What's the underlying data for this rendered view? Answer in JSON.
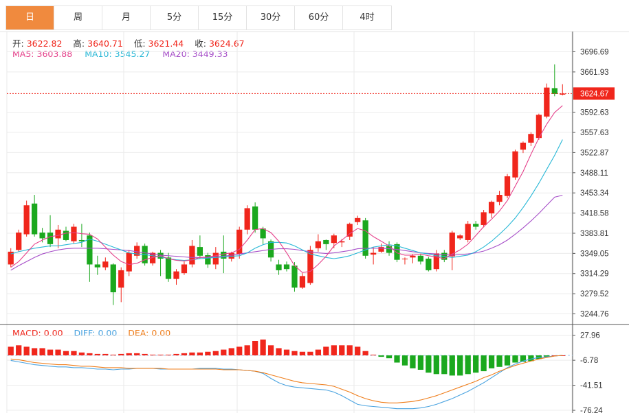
{
  "tabs": [
    {
      "label": "日",
      "active": true
    },
    {
      "label": "周",
      "active": false
    },
    {
      "label": "月",
      "active": false
    },
    {
      "label": "5分",
      "active": false
    },
    {
      "label": "15分",
      "active": false
    },
    {
      "label": "30分",
      "active": false
    },
    {
      "label": "60分",
      "active": false
    },
    {
      "label": "4时",
      "active": false
    }
  ],
  "ohlc_info": {
    "open_label": "开:",
    "open_value": "3622.82",
    "high_label": "高:",
    "high_value": "3640.71",
    "low_label": "低:",
    "low_value": "3621.44",
    "close_label": "收:",
    "close_value": "3624.67"
  },
  "ma_info": {
    "ma5_label": "MA5:",
    "ma5_value": "3603.88",
    "ma10_label": "MA10:",
    "ma10_value": "3545.27",
    "ma20_label": "MA20:",
    "ma20_value": "3449.33"
  },
  "macd_info": {
    "macd_label": "MACD:",
    "macd_value": "0.00",
    "diff_label": "DIFF:",
    "diff_value": "0.00",
    "dea_label": "DEA:",
    "dea_value": "0.00"
  },
  "last_price_label": "3624.67",
  "colors": {
    "up": "#f0261c",
    "down": "#1ba81e",
    "ma5": "#e5408a",
    "ma10": "#27b7d6",
    "ma20": "#a64ec8",
    "diff": "#4aa3e0",
    "dea": "#ef7d1a",
    "accent": "#f08a3e"
  },
  "chart_data": [
    {
      "type": "candlestick",
      "title": "",
      "ylim": [
        3230,
        3715
      ],
      "y_ticks": [
        "3696.69",
        "3661.93",
        "3592.63",
        "3557.63",
        "3522.87",
        "3488.11",
        "3453.34",
        "3418.58",
        "3383.81",
        "3349.05",
        "3314.29",
        "3279.52",
        "3244.76"
      ],
      "last_price": 3624.67,
      "candles": [
        [
          3330,
          3352,
          3325,
          3358
        ],
        [
          3355,
          3385,
          3352,
          3390
        ],
        [
          3382,
          3432,
          3378,
          3440
        ],
        [
          3435,
          3382,
          3378,
          3450
        ],
        [
          3385,
          3375,
          3368,
          3393
        ],
        [
          3385,
          3365,
          3360,
          3415
        ],
        [
          3375,
          3390,
          3358,
          3398
        ],
        [
          3388,
          3372,
          3370,
          3395
        ],
        [
          3370,
          3395,
          3366,
          3400
        ],
        [
          3372,
          3370,
          3360,
          3400
        ],
        [
          3380,
          3330,
          3300,
          3385
        ],
        [
          3330,
          3325,
          3312,
          3345
        ],
        [
          3325,
          3335,
          3320,
          3342
        ],
        [
          3330,
          3282,
          3260,
          3332
        ],
        [
          3290,
          3320,
          3265,
          3325
        ],
        [
          3318,
          3350,
          3310,
          3355
        ],
        [
          3345,
          3362,
          3340,
          3368
        ],
        [
          3362,
          3332,
          3328,
          3366
        ],
        [
          3332,
          3350,
          3328,
          3352
        ],
        [
          3350,
          3340,
          3310,
          3355
        ],
        [
          3342,
          3305,
          3300,
          3350
        ],
        [
          3305,
          3318,
          3295,
          3322
        ],
        [
          3315,
          3330,
          3312,
          3335
        ],
        [
          3330,
          3362,
          3325,
          3372
        ],
        [
          3360,
          3345,
          3340,
          3380
        ],
        [
          3346,
          3330,
          3324,
          3350
        ],
        [
          3330,
          3350,
          3322,
          3360
        ],
        [
          3352,
          3340,
          3315,
          3380
        ],
        [
          3340,
          3350,
          3335,
          3352
        ],
        [
          3348,
          3390,
          3340,
          3395
        ],
        [
          3390,
          3427,
          3382,
          3432
        ],
        [
          3430,
          3390,
          3385,
          3437
        ],
        [
          3392,
          3375,
          3365,
          3395
        ],
        [
          3370,
          3342,
          3335,
          3373
        ],
        [
          3330,
          3320,
          3312,
          3338
        ],
        [
          3330,
          3322,
          3318,
          3335
        ],
        [
          3328,
          3290,
          3283,
          3334
        ],
        [
          3290,
          3310,
          3288,
          3315
        ],
        [
          3298,
          3355,
          3295,
          3362
        ],
        [
          3358,
          3370,
          3352,
          3382
        ],
        [
          3372,
          3365,
          3355,
          3373
        ],
        [
          3367,
          3380,
          3358,
          3383
        ],
        [
          3368,
          3370,
          3360,
          3374
        ],
        [
          3378,
          3400,
          3372,
          3402
        ],
        [
          3403,
          3410,
          3398,
          3414
        ],
        [
          3406,
          3345,
          3340,
          3410
        ],
        [
          3347,
          3350,
          3330,
          3360
        ],
        [
          3352,
          3360,
          3350,
          3366
        ],
        [
          3362,
          3350,
          3345,
          3370
        ],
        [
          3365,
          3338,
          3334,
          3368
        ],
        [
          3340,
          3340,
          3330,
          3342
        ],
        [
          3342,
          3345,
          3332,
          3348
        ],
        [
          3345,
          3335,
          3330,
          3348
        ],
        [
          3340,
          3320,
          3318,
          3343
        ],
        [
          3322,
          3349,
          3318,
          3355
        ],
        [
          3350,
          3338,
          3334,
          3355
        ],
        [
          3344,
          3385,
          3320,
          3388
        ],
        [
          3375,
          3380,
          3372,
          3382
        ],
        [
          3372,
          3400,
          3368,
          3405
        ],
        [
          3400,
          3395,
          3390,
          3405
        ],
        [
          3398,
          3420,
          3394,
          3424
        ],
        [
          3418,
          3438,
          3410,
          3440
        ],
        [
          3438,
          3450,
          3432,
          3457
        ],
        [
          3448,
          3482,
          3444,
          3486
        ],
        [
          3480,
          3525,
          3476,
          3528
        ],
        [
          3528,
          3540,
          3522,
          3542
        ],
        [
          3540,
          3555,
          3534,
          3558
        ],
        [
          3548,
          3588,
          3545,
          3590
        ],
        [
          3585,
          3635,
          3582,
          3642
        ],
        [
          3634,
          3624,
          3620,
          3675
        ],
        [
          3622.82,
          3624.67,
          3621.44,
          3640.71
        ]
      ],
      "ma5": [
        3325,
        3335,
        3350,
        3365,
        3372,
        3378,
        3380,
        3384,
        3385,
        3383,
        3382,
        3374,
        3360,
        3346,
        3335,
        3330,
        3332,
        3338,
        3342,
        3345,
        3340,
        3337,
        3336,
        3338,
        3342,
        3343,
        3345,
        3348,
        3350,
        3356,
        3372,
        3390,
        3392,
        3385,
        3370,
        3350,
        3328,
        3316,
        3318,
        3330,
        3344,
        3362,
        3372,
        3383,
        3392,
        3388,
        3378,
        3370,
        3362,
        3350,
        3346,
        3346,
        3348,
        3345,
        3343,
        3340,
        3348,
        3355,
        3365,
        3380,
        3395,
        3408,
        3422,
        3440,
        3465,
        3490,
        3520,
        3548,
        3572,
        3592,
        3603.88
      ],
      "ma10": [
        3348,
        3352,
        3355,
        3358,
        3360,
        3362,
        3362,
        3364,
        3366,
        3368,
        3374,
        3370,
        3365,
        3360,
        3355,
        3350,
        3348,
        3347,
        3345,
        3343,
        3340,
        3338,
        3337,
        3338,
        3340,
        3341,
        3342,
        3343,
        3344,
        3345,
        3350,
        3358,
        3364,
        3368,
        3368,
        3367,
        3362,
        3355,
        3348,
        3345,
        3342,
        3340,
        3342,
        3345,
        3350,
        3355,
        3360,
        3362,
        3364,
        3362,
        3358,
        3354,
        3350,
        3348,
        3345,
        3344,
        3342,
        3344,
        3346,
        3352,
        3360,
        3370,
        3382,
        3395,
        3410,
        3428,
        3448,
        3470,
        3494,
        3518,
        3545.27
      ],
      "ma20": [
        3320,
        3328,
        3335,
        3342,
        3348,
        3352,
        3355,
        3357,
        3358,
        3358,
        3358,
        3358,
        3357,
        3356,
        3355,
        3354,
        3352,
        3350,
        3348,
        3346,
        3345,
        3344,
        3343,
        3342,
        3342,
        3342,
        3343,
        3344,
        3346,
        3348,
        3350,
        3352,
        3354,
        3356,
        3357,
        3357,
        3356,
        3354,
        3352,
        3350,
        3349,
        3350,
        3352,
        3354,
        3357,
        3358,
        3358,
        3358,
        3357,
        3356,
        3354,
        3352,
        3350,
        3349,
        3348,
        3347,
        3346,
        3347,
        3348,
        3350,
        3353,
        3358,
        3364,
        3372,
        3382,
        3393,
        3405,
        3418,
        3432,
        3446,
        3449.33
      ]
    },
    {
      "type": "bar",
      "title": "MACD",
      "ylim": [
        -80,
        40
      ],
      "y_ticks": [
        "27.96",
        "-6.78",
        "-41.51",
        "-76.24"
      ],
      "macd": [
        12,
        14,
        12,
        10,
        10,
        8,
        8,
        6,
        6,
        4,
        3,
        2,
        2,
        1,
        2,
        3,
        3,
        2,
        1,
        1,
        1,
        2,
        3,
        4,
        4,
        5,
        6,
        8,
        10,
        12,
        14,
        20,
        22,
        14,
        10,
        8,
        6,
        5,
        5,
        8,
        12,
        14,
        14,
        14,
        12,
        6,
        1,
        -2,
        -4,
        -10,
        -14,
        -18,
        -20,
        -24,
        -26,
        -26,
        -28,
        -28,
        -26,
        -24,
        -22,
        -18,
        -16,
        -14,
        -10,
        -9,
        -8,
        -5,
        -2,
        0,
        0
      ],
      "diff": [
        -7,
        -9,
        -11,
        -13,
        -14,
        -15,
        -16,
        -16,
        -17,
        -17,
        -18,
        -19,
        -19,
        -20,
        -19,
        -19,
        -18,
        -18,
        -18,
        -19,
        -19,
        -19,
        -19,
        -19,
        -18,
        -18,
        -18,
        -19,
        -19,
        -20,
        -21,
        -22,
        -25,
        -32,
        -38,
        -42,
        -44,
        -45,
        -46,
        -47,
        -48,
        -51,
        -56,
        -62,
        -68,
        -70,
        -71,
        -72,
        -73,
        -74,
        -74,
        -74,
        -73,
        -71,
        -68,
        -64,
        -60,
        -55,
        -50,
        -44,
        -38,
        -31,
        -24,
        -17,
        -12,
        -8,
        -5,
        -3,
        -2,
        -1,
        0
      ],
      "dea": [
        -5,
        -6,
        -8,
        -10,
        -11,
        -12,
        -13,
        -13,
        -14,
        -15,
        -15,
        -16,
        -17,
        -17,
        -17,
        -18,
        -18,
        -18,
        -18,
        -18,
        -19,
        -19,
        -19,
        -19,
        -19,
        -19,
        -19,
        -20,
        -20,
        -20,
        -21,
        -22,
        -24,
        -27,
        -30,
        -33,
        -36,
        -38,
        -39,
        -40,
        -41,
        -43,
        -47,
        -51,
        -56,
        -60,
        -63,
        -65,
        -66,
        -66,
        -65,
        -64,
        -62,
        -59,
        -56,
        -52,
        -48,
        -44,
        -40,
        -36,
        -31,
        -27,
        -22,
        -18,
        -14,
        -11,
        -8,
        -5,
        -3,
        -1,
        0
      ]
    }
  ]
}
